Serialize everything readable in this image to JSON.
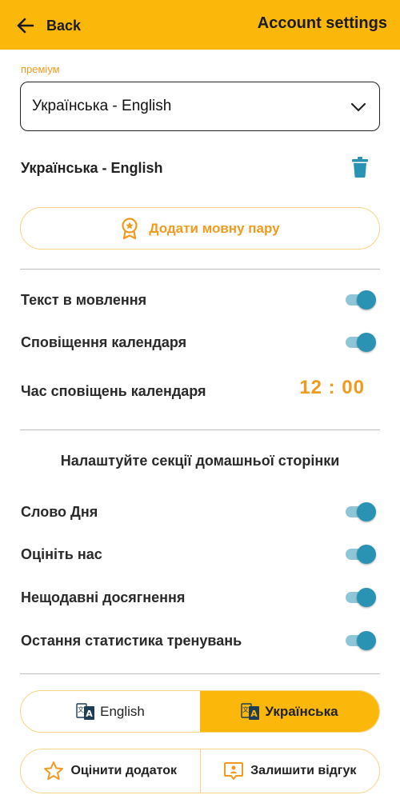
{
  "header": {
    "back_label": "Back",
    "title": "Account settings"
  },
  "language_pair": {
    "section_label": "преміум",
    "selected": "Українська - English",
    "current_pair": "Українська - English",
    "add_button": "Додати мовну пару"
  },
  "settings": [
    {
      "label": "Текст в мовлення",
      "enabled": true
    },
    {
      "label": "Сповіщення календаря",
      "enabled": true
    }
  ],
  "notification_time": {
    "label": "Час сповіщень календаря",
    "value": "12 : 00"
  },
  "home_sections": {
    "heading": "Налаштуйте секції домашньої сторінки",
    "items": [
      {
        "label": "Слово Дня",
        "enabled": true
      },
      {
        "label": "Оцініть нас",
        "enabled": true
      },
      {
        "label": "Нещодавні досягнення",
        "enabled": true
      },
      {
        "label": "Остання статистика тренувань",
        "enabled": true
      }
    ]
  },
  "interface_language": {
    "options": [
      "English",
      "Українська"
    ],
    "selected": "Українська"
  },
  "actions": {
    "rate_app": "Оцінити додаток",
    "leave_feedback": "Залишити відгук"
  },
  "colors": {
    "accent": "#FBB70A",
    "accent_text": "#F29A1F",
    "toggle_on": "#2A93B4",
    "toggle_track": "#8EC6D7",
    "trash": "#2A93B4"
  },
  "icons": [
    "back-arrow-icon",
    "chevron-down-icon",
    "trash-icon",
    "award-badge-icon",
    "translate-icon",
    "star-icon",
    "feedback-icon"
  ]
}
